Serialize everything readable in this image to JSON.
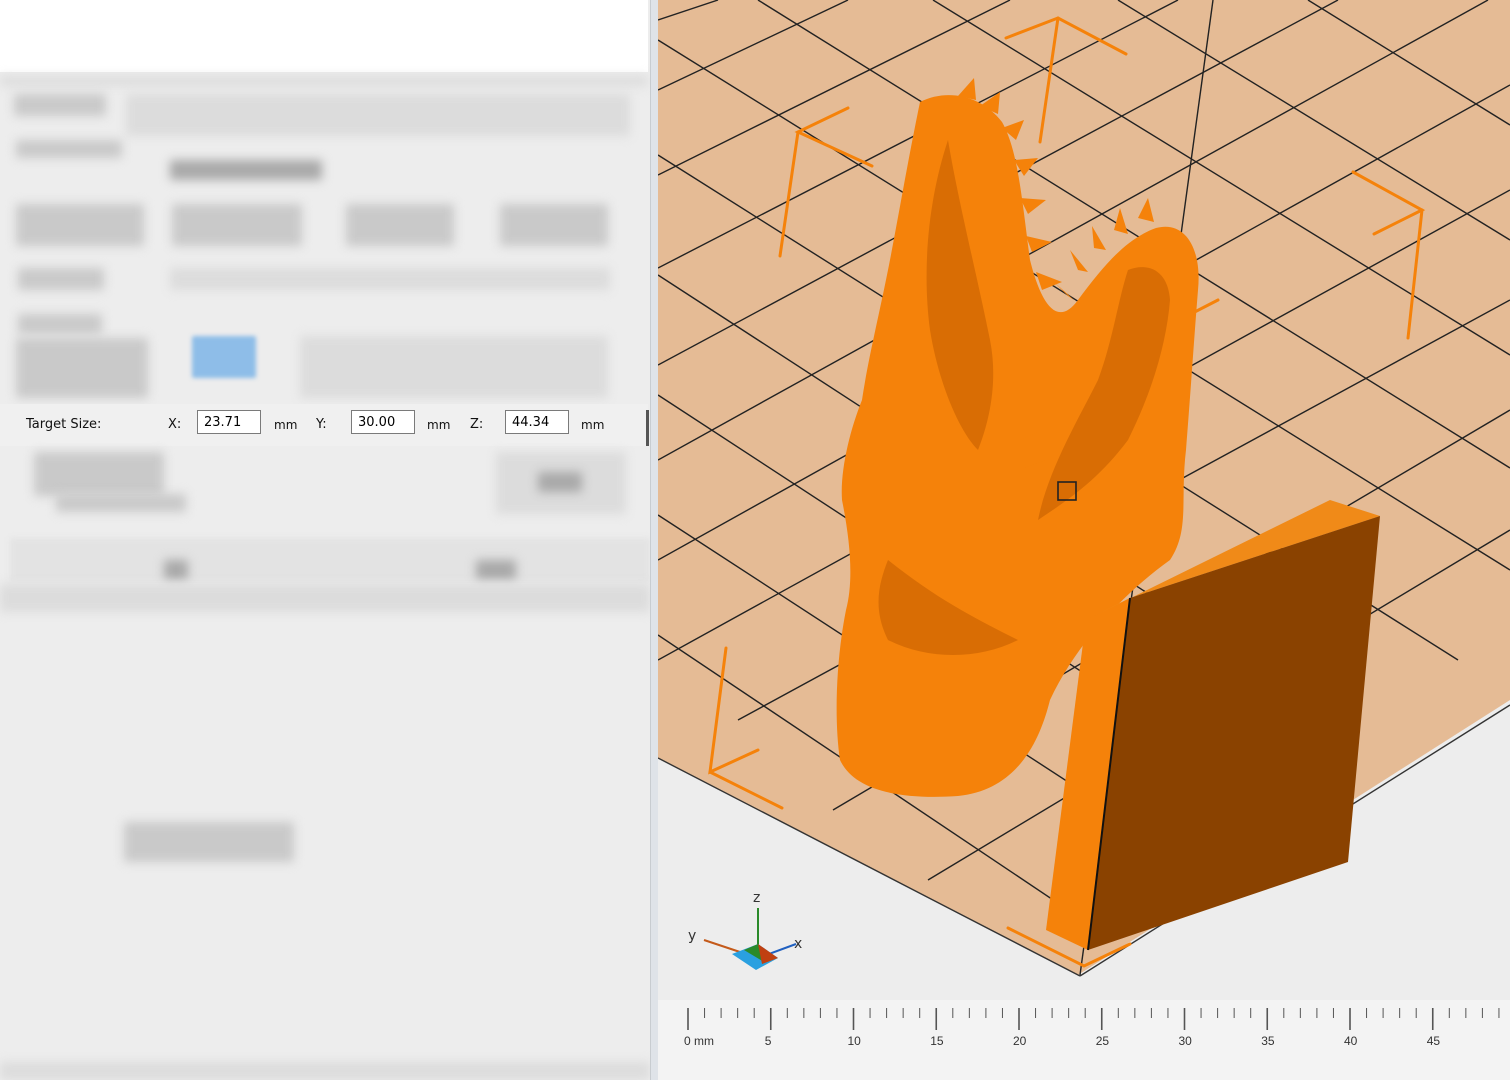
{
  "target_size": {
    "label": "Target Size:",
    "x": {
      "axis_label": "X:",
      "value": "23.71",
      "unit": "mm"
    },
    "y": {
      "axis_label": "Y:",
      "value": "30.00",
      "unit": "mm"
    },
    "z": {
      "axis_label": "Z:",
      "value": "44.34",
      "unit": "mm"
    }
  },
  "axis_gizmo": {
    "x": "x",
    "y": "y",
    "z": "z"
  },
  "ruler": {
    "labels": [
      "0 mm",
      "5",
      "10",
      "15",
      "20",
      "25",
      "30",
      "35",
      "40",
      "45"
    ]
  },
  "colors": {
    "model": "#f5820a",
    "plate": "#e5bb95",
    "panel": "#ededed"
  }
}
